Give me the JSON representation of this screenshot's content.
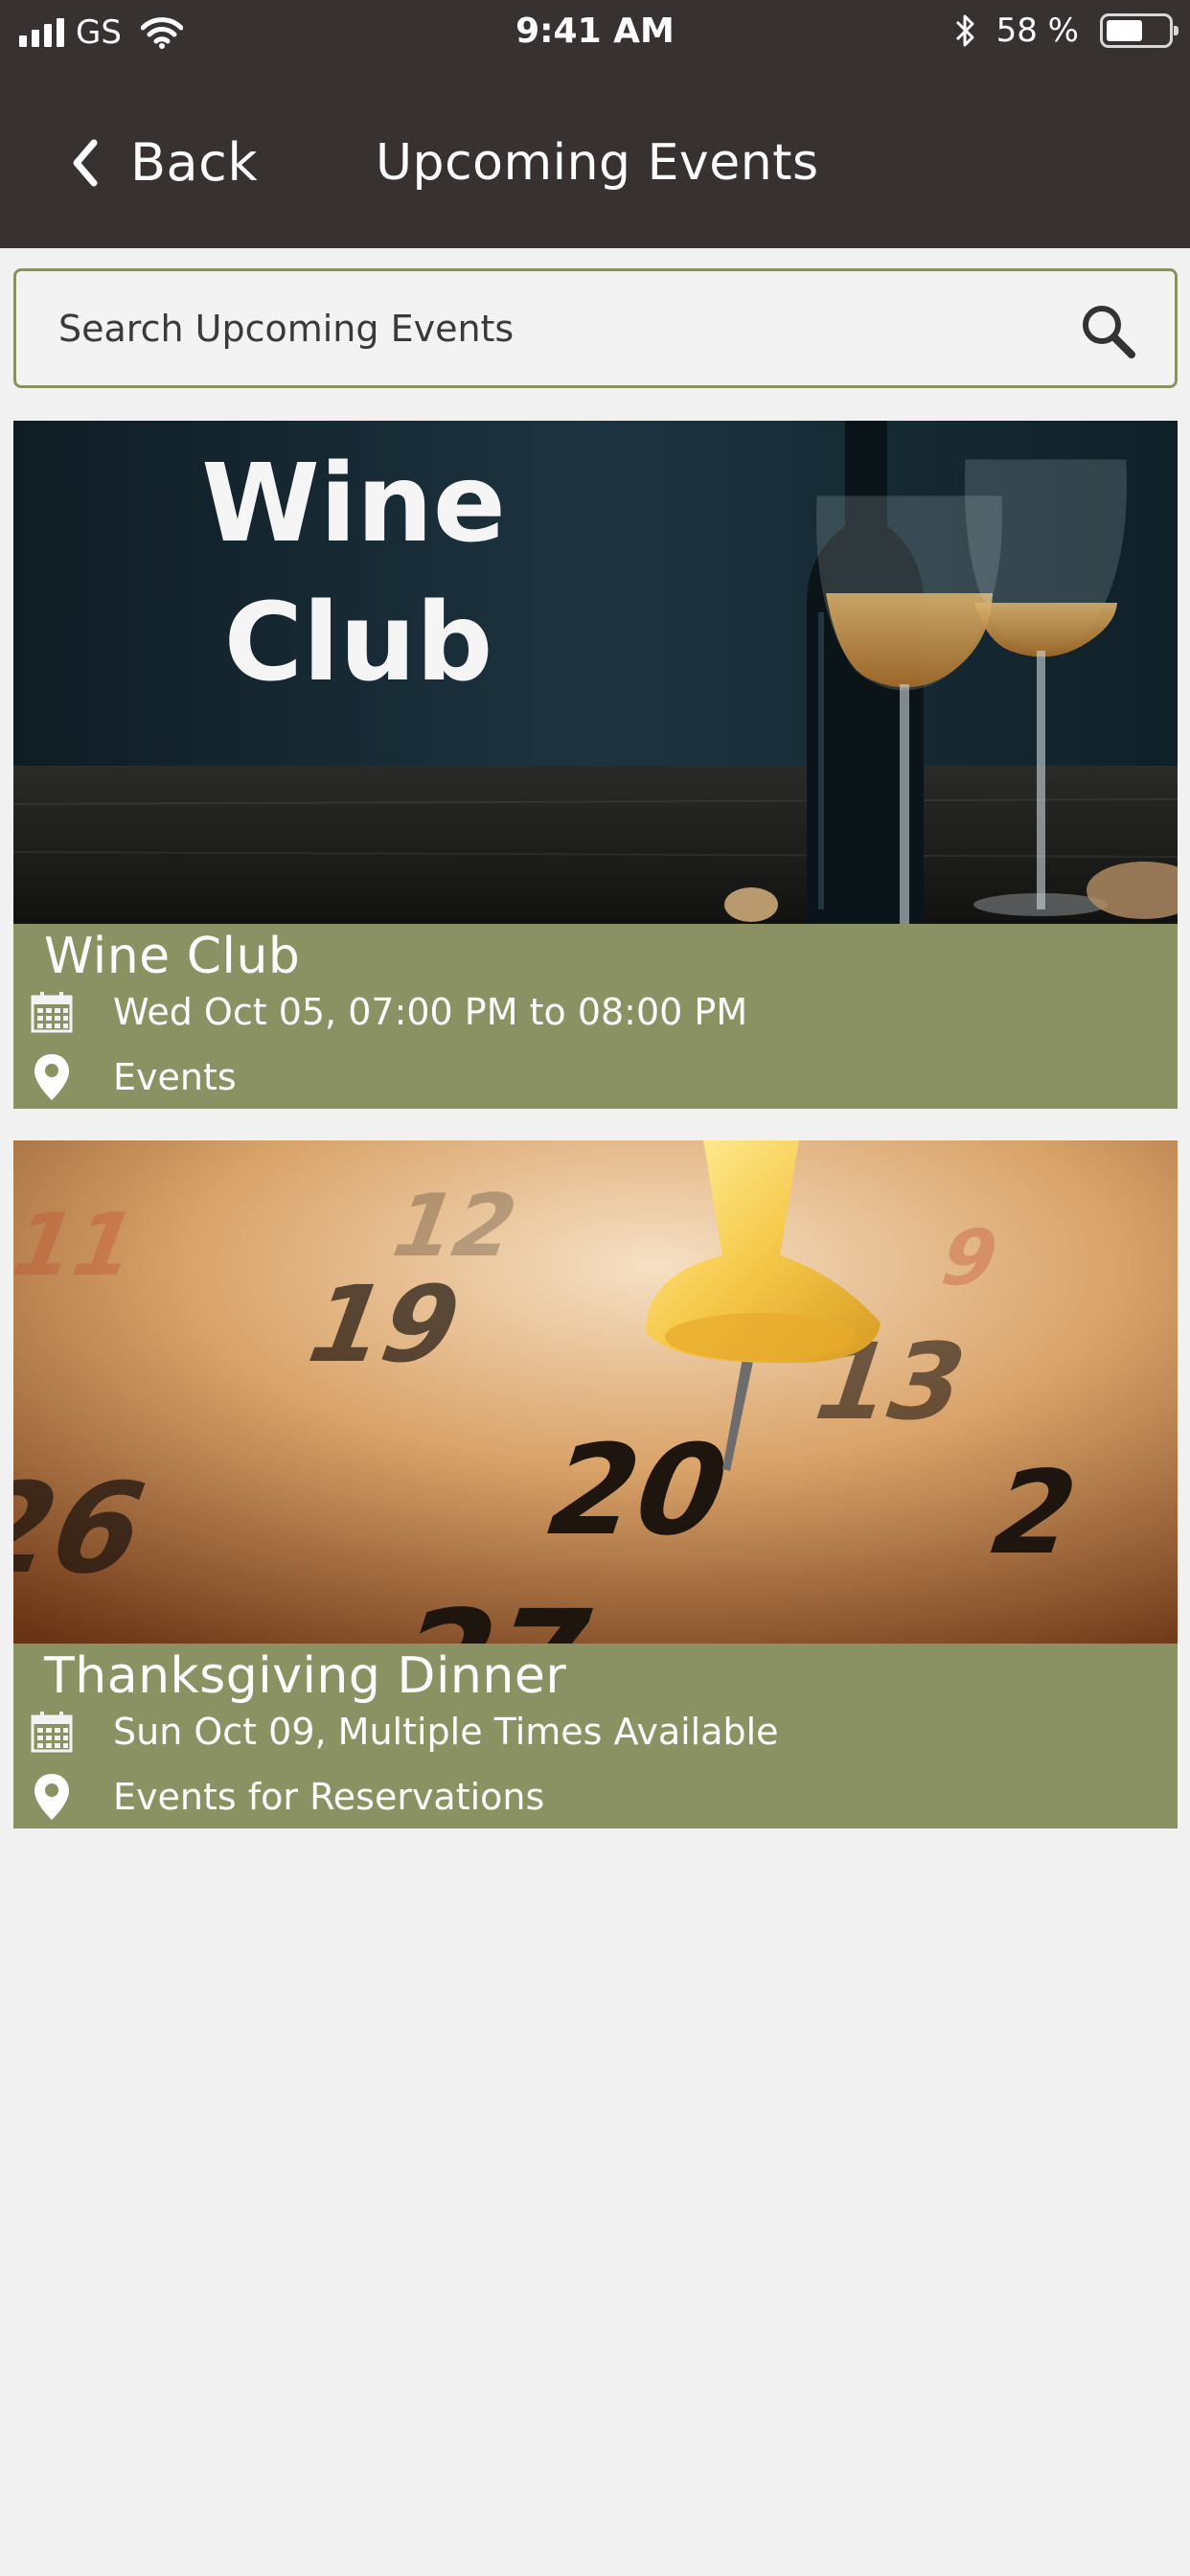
{
  "status_bar": {
    "carrier": "GS",
    "time": "9:41 AM",
    "battery_percent": "58 %",
    "battery_level": 0.58
  },
  "header": {
    "back_label": "Back",
    "title": "Upcoming Events"
  },
  "search": {
    "placeholder": "Search Upcoming Events",
    "value": ""
  },
  "events": [
    {
      "title": "Wine Club",
      "image_text": [
        "Wine",
        "Club"
      ],
      "date": "Wed Oct 05, 07:00 PM to 08:00 PM",
      "location": "Events"
    },
    {
      "title": "Thanksgiving Dinner",
      "date": "Sun Oct 09, Multiple Times Available",
      "location": "Events for Reservations"
    }
  ],
  "colors": {
    "header_bg": "#373132",
    "accent_olive": "#8a9263",
    "page_bg": "#f1f1f1"
  }
}
